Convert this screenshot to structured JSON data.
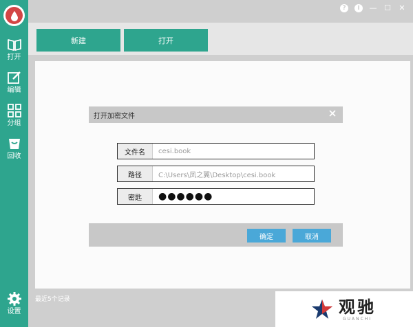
{
  "window": {
    "controls": [
      "?",
      "i",
      "—",
      "☐",
      "✕"
    ]
  },
  "sidebar": {
    "items": [
      {
        "label": "打开",
        "icon": "book-icon"
      },
      {
        "label": "编辑",
        "icon": "edit-icon"
      },
      {
        "label": "分组",
        "icon": "grid-icon"
      },
      {
        "label": "回收",
        "icon": "trash-icon"
      },
      {
        "label": "设置",
        "icon": "gear-icon"
      }
    ]
  },
  "toolbar": {
    "new_label": "新建",
    "open_label": "打开"
  },
  "dialog": {
    "title": "打开加密文件",
    "fields": [
      {
        "label": "文件名",
        "value": "cesi.book"
      },
      {
        "label": "路径",
        "value": "C:\\Users\\凤之翼\\Desktop\\cesi.book"
      },
      {
        "label": "密匙",
        "value": "●●●●●●"
      }
    ],
    "ok_label": "确定",
    "cancel_label": "取消"
  },
  "status": {
    "recent_text": "最近5个记录"
  },
  "watermark": {
    "text": "观驰",
    "subtext": "GUANCHI"
  },
  "colors": {
    "accent": "#2ea58e",
    "dialog_button": "#4aa8d8",
    "logo": "#d34545"
  }
}
